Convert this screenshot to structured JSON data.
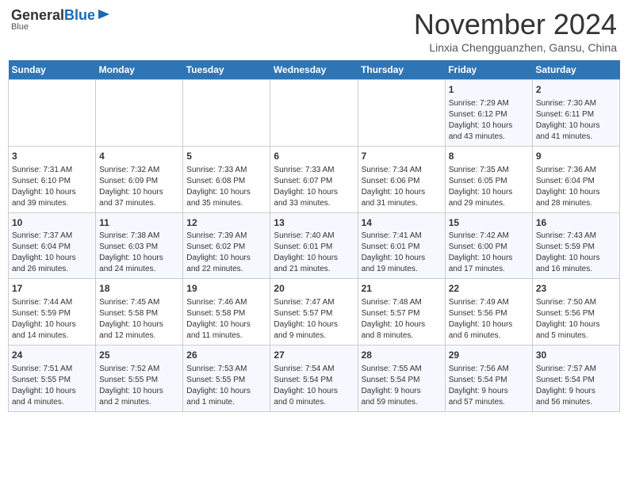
{
  "header": {
    "logo_line1": "General",
    "logo_line2": "Blue",
    "month": "November 2024",
    "location": "Linxia Chengguanzhen, Gansu, China"
  },
  "days_of_week": [
    "Sunday",
    "Monday",
    "Tuesday",
    "Wednesday",
    "Thursday",
    "Friday",
    "Saturday"
  ],
  "weeks": [
    [
      {
        "day": "",
        "info": ""
      },
      {
        "day": "",
        "info": ""
      },
      {
        "day": "",
        "info": ""
      },
      {
        "day": "",
        "info": ""
      },
      {
        "day": "",
        "info": ""
      },
      {
        "day": "1",
        "info": "Sunrise: 7:29 AM\nSunset: 6:12 PM\nDaylight: 10 hours\nand 43 minutes."
      },
      {
        "day": "2",
        "info": "Sunrise: 7:30 AM\nSunset: 6:11 PM\nDaylight: 10 hours\nand 41 minutes."
      }
    ],
    [
      {
        "day": "3",
        "info": "Sunrise: 7:31 AM\nSunset: 6:10 PM\nDaylight: 10 hours\nand 39 minutes."
      },
      {
        "day": "4",
        "info": "Sunrise: 7:32 AM\nSunset: 6:09 PM\nDaylight: 10 hours\nand 37 minutes."
      },
      {
        "day": "5",
        "info": "Sunrise: 7:33 AM\nSunset: 6:08 PM\nDaylight: 10 hours\nand 35 minutes."
      },
      {
        "day": "6",
        "info": "Sunrise: 7:33 AM\nSunset: 6:07 PM\nDaylight: 10 hours\nand 33 minutes."
      },
      {
        "day": "7",
        "info": "Sunrise: 7:34 AM\nSunset: 6:06 PM\nDaylight: 10 hours\nand 31 minutes."
      },
      {
        "day": "8",
        "info": "Sunrise: 7:35 AM\nSunset: 6:05 PM\nDaylight: 10 hours\nand 29 minutes."
      },
      {
        "day": "9",
        "info": "Sunrise: 7:36 AM\nSunset: 6:04 PM\nDaylight: 10 hours\nand 28 minutes."
      }
    ],
    [
      {
        "day": "10",
        "info": "Sunrise: 7:37 AM\nSunset: 6:04 PM\nDaylight: 10 hours\nand 26 minutes."
      },
      {
        "day": "11",
        "info": "Sunrise: 7:38 AM\nSunset: 6:03 PM\nDaylight: 10 hours\nand 24 minutes."
      },
      {
        "day": "12",
        "info": "Sunrise: 7:39 AM\nSunset: 6:02 PM\nDaylight: 10 hours\nand 22 minutes."
      },
      {
        "day": "13",
        "info": "Sunrise: 7:40 AM\nSunset: 6:01 PM\nDaylight: 10 hours\nand 21 minutes."
      },
      {
        "day": "14",
        "info": "Sunrise: 7:41 AM\nSunset: 6:01 PM\nDaylight: 10 hours\nand 19 minutes."
      },
      {
        "day": "15",
        "info": "Sunrise: 7:42 AM\nSunset: 6:00 PM\nDaylight: 10 hours\nand 17 minutes."
      },
      {
        "day": "16",
        "info": "Sunrise: 7:43 AM\nSunset: 5:59 PM\nDaylight: 10 hours\nand 16 minutes."
      }
    ],
    [
      {
        "day": "17",
        "info": "Sunrise: 7:44 AM\nSunset: 5:59 PM\nDaylight: 10 hours\nand 14 minutes."
      },
      {
        "day": "18",
        "info": "Sunrise: 7:45 AM\nSunset: 5:58 PM\nDaylight: 10 hours\nand 12 minutes."
      },
      {
        "day": "19",
        "info": "Sunrise: 7:46 AM\nSunset: 5:58 PM\nDaylight: 10 hours\nand 11 minutes."
      },
      {
        "day": "20",
        "info": "Sunrise: 7:47 AM\nSunset: 5:57 PM\nDaylight: 10 hours\nand 9 minutes."
      },
      {
        "day": "21",
        "info": "Sunrise: 7:48 AM\nSunset: 5:57 PM\nDaylight: 10 hours\nand 8 minutes."
      },
      {
        "day": "22",
        "info": "Sunrise: 7:49 AM\nSunset: 5:56 PM\nDaylight: 10 hours\nand 6 minutes."
      },
      {
        "day": "23",
        "info": "Sunrise: 7:50 AM\nSunset: 5:56 PM\nDaylight: 10 hours\nand 5 minutes."
      }
    ],
    [
      {
        "day": "24",
        "info": "Sunrise: 7:51 AM\nSunset: 5:55 PM\nDaylight: 10 hours\nand 4 minutes."
      },
      {
        "day": "25",
        "info": "Sunrise: 7:52 AM\nSunset: 5:55 PM\nDaylight: 10 hours\nand 2 minutes."
      },
      {
        "day": "26",
        "info": "Sunrise: 7:53 AM\nSunset: 5:55 PM\nDaylight: 10 hours\nand 1 minute."
      },
      {
        "day": "27",
        "info": "Sunrise: 7:54 AM\nSunset: 5:54 PM\nDaylight: 10 hours\nand 0 minutes."
      },
      {
        "day": "28",
        "info": "Sunrise: 7:55 AM\nSunset: 5:54 PM\nDaylight: 9 hours\nand 59 minutes."
      },
      {
        "day": "29",
        "info": "Sunrise: 7:56 AM\nSunset: 5:54 PM\nDaylight: 9 hours\nand 57 minutes."
      },
      {
        "day": "30",
        "info": "Sunrise: 7:57 AM\nSunset: 5:54 PM\nDaylight: 9 hours\nand 56 minutes."
      }
    ]
  ]
}
